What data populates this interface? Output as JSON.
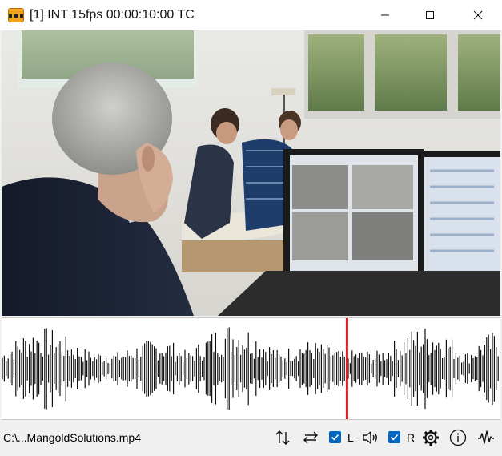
{
  "window": {
    "title": "[1] INT 15fps   00:00:10:00 TC",
    "icons": [
      "app-logo-icon",
      "minimize-icon",
      "maximize-icon",
      "close-icon"
    ]
  },
  "video": {
    "description_icon": "video-frame"
  },
  "waveform": {
    "playhead_position": 0.69,
    "playhead_color": "#e8191f",
    "wave_color": "#111111"
  },
  "statusbar": {
    "filename": "C:\\...MangoldSolutions.mp4",
    "left_channel": {
      "label": "L",
      "checked": true
    },
    "right_channel": {
      "label": "R",
      "checked": true
    },
    "icons": [
      "vertical-arrows-icon",
      "horizontal-arrows-icon",
      "speaker-icon",
      "gear-icon",
      "info-icon",
      "waveform-icon"
    ],
    "accent": "#0067c0"
  }
}
